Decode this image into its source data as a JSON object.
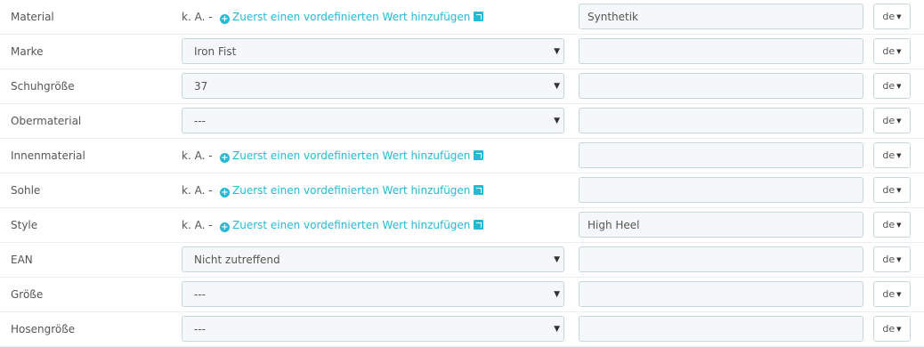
{
  "rows": [
    {
      "label": "Material",
      "type": "na",
      "na_text": "k. A. -",
      "link_text": "Zuerst einen vordefinierten Wert hinzufügen",
      "value": "Synthetik",
      "lang": "de"
    },
    {
      "label": "Marke",
      "type": "select",
      "selected": "Iron Fist",
      "value": "",
      "lang": "de"
    },
    {
      "label": "Schuhgröße",
      "type": "select",
      "selected": "37",
      "value": "",
      "lang": "de"
    },
    {
      "label": "Obermaterial",
      "type": "select",
      "selected": "---",
      "value": "",
      "lang": "de"
    },
    {
      "label": "Innenmaterial",
      "type": "na",
      "na_text": "k. A. -",
      "link_text": "Zuerst einen vordefinierten Wert hinzufügen",
      "value": "",
      "lang": "de"
    },
    {
      "label": "Sohle",
      "type": "na",
      "na_text": "k. A. -",
      "link_text": "Zuerst einen vordefinierten Wert hinzufügen",
      "value": "",
      "lang": "de"
    },
    {
      "label": "Style",
      "type": "na",
      "na_text": "k. A. -",
      "link_text": "Zuerst einen vordefinierten Wert hinzufügen",
      "value": "High Heel",
      "lang": "de"
    },
    {
      "label": "EAN",
      "type": "select",
      "selected": "Nicht zutreffend",
      "value": "",
      "lang": "de"
    },
    {
      "label": "Größe",
      "type": "select",
      "selected": "---",
      "value": "",
      "lang": "de"
    },
    {
      "label": "Hosengröße",
      "type": "select",
      "selected": "---",
      "value": "",
      "lang": "de"
    }
  ],
  "icons": {
    "add": "plus-circle-icon",
    "external": "external-link-icon",
    "caret": "caret-down-icon"
  },
  "colors": {
    "link": "#25b9d7",
    "input_bg": "#f5f8f9",
    "border": "#c7d6db"
  }
}
